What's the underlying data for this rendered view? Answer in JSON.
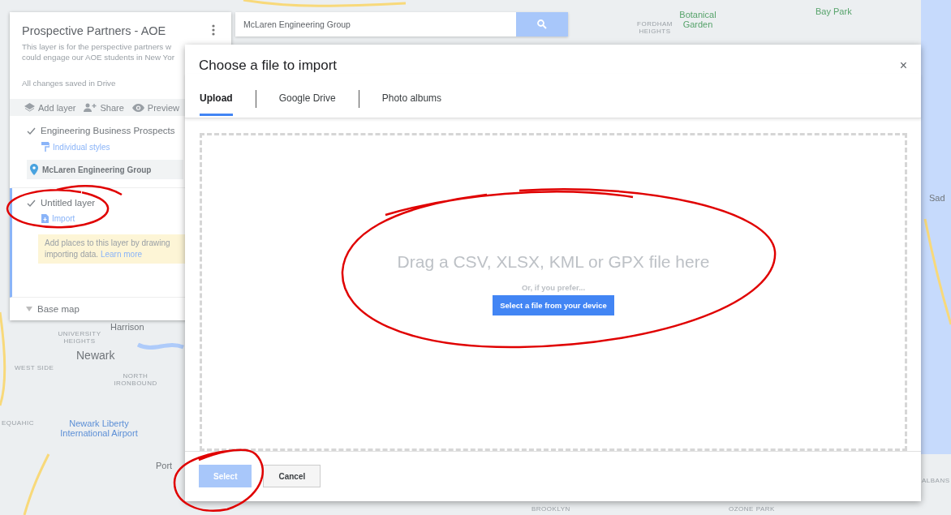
{
  "map": {
    "labels": [
      {
        "text": "Harrison",
        "kind": "place"
      },
      {
        "text": "UNIVERSITY HEIGHTS",
        "kind": "district"
      },
      {
        "text": "Newark",
        "kind": "city"
      },
      {
        "text": "WEST SIDE",
        "kind": "district"
      },
      {
        "text": "NORTH IRONBOUND",
        "kind": "district"
      },
      {
        "text": "EQUAHIC",
        "kind": "district"
      },
      {
        "text": "Newark Liberty International Airport",
        "kind": "poi"
      },
      {
        "text": "Port",
        "kind": "place"
      },
      {
        "text": "BROOKLYN",
        "kind": "district"
      },
      {
        "text": "OZONE PARK",
        "kind": "district"
      },
      {
        "text": "Bay Park",
        "kind": "park"
      },
      {
        "text": "Botanical Garden",
        "kind": "park"
      },
      {
        "text": "FORDHAM HEIGHTS",
        "kind": "district"
      },
      {
        "text": "Sad",
        "kind": "place"
      },
      {
        "text": "ALBANS",
        "kind": "district"
      }
    ]
  },
  "panel": {
    "title": "Prospective Partners - AOE",
    "description": [
      "This layer is for the perspective partners w",
      "could engage our AOE students in New Yor"
    ],
    "status": "All changes saved in Drive",
    "actions": [
      "Add layer",
      "Share",
      "Preview"
    ],
    "layers": [
      {
        "name": "Engineering Business Prospects",
        "checked": true,
        "active": false,
        "link": "Individual styles",
        "kind": "style",
        "places": [
          {
            "name": "McLaren Engineering Group"
          }
        ]
      },
      {
        "name": "Untitled layer",
        "checked": true,
        "active": true,
        "link": "Import",
        "kind": "import",
        "hint": "Add places to this layer by drawing importing data.",
        "hint_link": "Learn more"
      }
    ],
    "base_map": {
      "label": "Base map",
      "expanded": false
    }
  },
  "search": {
    "value": "McLaren Engineering Group"
  },
  "dialog": {
    "title": "Choose a file to import",
    "close": "×",
    "tabs": [
      {
        "label": "Upload",
        "selected": true
      },
      {
        "label": "Google Drive",
        "selected": false
      },
      {
        "label": "Photo albums",
        "selected": false
      }
    ],
    "drop_text": "Drag a CSV, XLSX, KML or GPX file here",
    "alt_text": "Or, if you prefer...",
    "device_button": "Select a file from your device",
    "buttons": [
      {
        "label": "Select",
        "kind": "primary",
        "disabled": true
      },
      {
        "label": "Cancel",
        "kind": "secondary",
        "disabled": false
      }
    ]
  }
}
